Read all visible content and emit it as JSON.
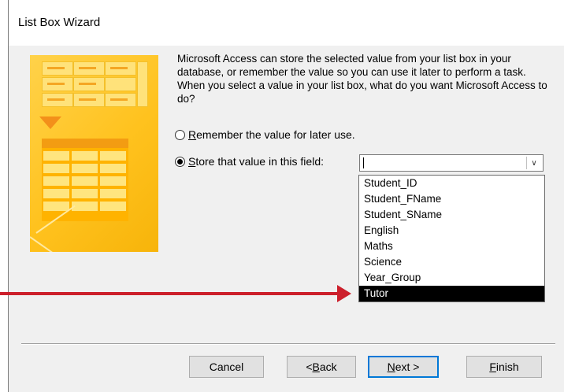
{
  "window": {
    "title": "List Box Wizard"
  },
  "description": "Microsoft Access can store the selected value from your list box in your database, or remember the value so you can use it later to perform a task.  When you select a value in your list box, what do you want Microsoft Access to do?",
  "options": {
    "remember": {
      "prefix": "",
      "mnemonic": "R",
      "rest": "emember the value for later use.",
      "checked": false
    },
    "store": {
      "prefix": "",
      "mnemonic": "S",
      "rest": "tore that value in this field:",
      "checked": true
    }
  },
  "field_combo": {
    "value": ""
  },
  "field_list": {
    "items": [
      "Student_ID",
      "Student_FName",
      "Student_SName",
      "English",
      "Maths",
      "Science",
      "Year_Group",
      "Tutor"
    ],
    "selected": "Tutor"
  },
  "buttons": {
    "cancel": {
      "label": "Cancel"
    },
    "back": {
      "prefix": "< ",
      "mnemonic": "B",
      "rest": "ack"
    },
    "next": {
      "prefix": "",
      "mnemonic": "N",
      "rest": "ext >"
    },
    "finish": {
      "prefix": "",
      "mnemonic": "F",
      "rest": "inish"
    }
  },
  "colors": {
    "annotation_arrow": "#cc1f2b",
    "selection": "#000000",
    "default_button_border": "#0078d7"
  }
}
